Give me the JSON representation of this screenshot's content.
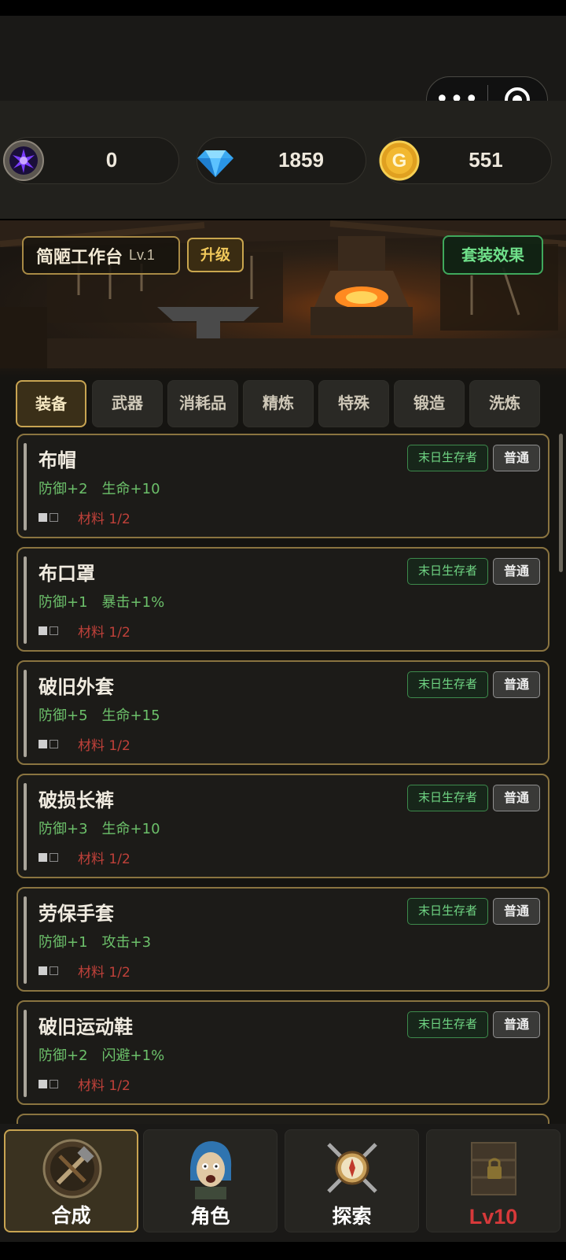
{
  "resources": {
    "orb": {
      "value": "0",
      "icon": "purple-orb-icon"
    },
    "gems": {
      "value": "1859",
      "icon": "diamond-icon"
    },
    "gold": {
      "value": "551",
      "icon": "gold-coin-icon",
      "coin_letter": "G"
    }
  },
  "capsule": {
    "more": "•••",
    "close_icon": "target-icon"
  },
  "workbench": {
    "name": "简陋工作台",
    "level": "Lv.1",
    "upgrade_label": "升级",
    "set_effect_label": "套装效果"
  },
  "tabs": [
    "装备",
    "武器",
    "消耗品",
    "精炼",
    "特殊",
    "锻造",
    "洗炼"
  ],
  "active_tab": 0,
  "items": [
    {
      "name": "布帽",
      "stats": [
        "防御+2",
        "生命+10"
      ],
      "material": "材料 1/2",
      "tag": "末日生存者",
      "rarity": "普通"
    },
    {
      "name": "布口罩",
      "stats": [
        "防御+1",
        "暴击+1%"
      ],
      "material": "材料 1/2",
      "tag": "末日生存者",
      "rarity": "普通"
    },
    {
      "name": "破旧外套",
      "stats": [
        "防御+5",
        "生命+15"
      ],
      "material": "材料 1/2",
      "tag": "末日生存者",
      "rarity": "普通"
    },
    {
      "name": "破损长裤",
      "stats": [
        "防御+3",
        "生命+10"
      ],
      "material": "材料 1/2",
      "tag": "末日生存者",
      "rarity": "普通"
    },
    {
      "name": "劳保手套",
      "stats": [
        "防御+1",
        "攻击+3"
      ],
      "material": "材料 1/2",
      "tag": "末日生存者",
      "rarity": "普通"
    },
    {
      "name": "破旧运动鞋",
      "stats": [
        "防御+2",
        "闪避+1%"
      ],
      "material": "材料 1/2",
      "tag": "末日生存者",
      "rarity": "普通"
    }
  ],
  "nav": [
    {
      "label": "合成",
      "icon": "crafting-tools-icon"
    },
    {
      "label": "角色",
      "icon": "character-avatar-icon"
    },
    {
      "label": "探索",
      "icon": "compass-swords-icon"
    },
    {
      "label": "Lv10",
      "icon": "locked-shelf-icon"
    }
  ],
  "colors": {
    "accent_gold": "#c8a452",
    "stat_green": "#6cc06a",
    "material_red": "#c0413a",
    "level_red": "#d7393a"
  }
}
